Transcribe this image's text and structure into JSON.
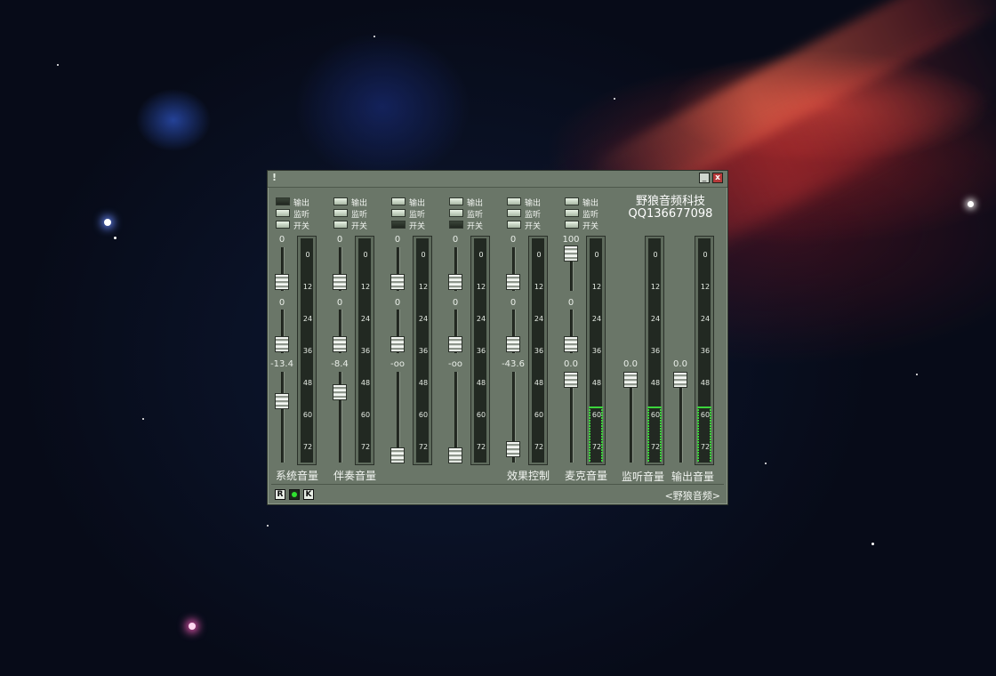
{
  "window": {
    "title_glyph": "!",
    "minimize_label": "_",
    "close_label": "x",
    "brand_line1": "野狼音频科技",
    "brand_line2": "QQ136677098",
    "footer_text": "<野狼音频>",
    "status_buttons": [
      "R",
      "",
      "K"
    ]
  },
  "toggle_labels": [
    "输出",
    "监听",
    "开关"
  ],
  "meter_ticks": [
    "0",
    "12",
    "24",
    "36",
    "48",
    "60",
    "72"
  ],
  "channels": [
    {
      "label": "系统音量",
      "values": [
        "0",
        "0",
        "-13.4"
      ],
      "toggles": [
        false,
        true,
        true
      ]
    },
    {
      "label": "伴奏音量",
      "values": [
        "0",
        "0",
        "-8.4"
      ],
      "toggles": [
        true,
        true,
        true
      ]
    },
    {
      "label": "",
      "values": [
        "0",
        "0",
        "-oo"
      ],
      "toggles": [
        true,
        true,
        false
      ]
    },
    {
      "label": "",
      "values": [
        "0",
        "0",
        "-oo"
      ],
      "toggles": [
        true,
        true,
        false
      ]
    },
    {
      "label": "效果控制",
      "values": [
        "0",
        "0",
        "-43.6"
      ],
      "toggles": [
        true,
        true,
        true
      ]
    },
    {
      "label": "麦克音量",
      "values": [
        "100",
        "0",
        "0.0"
      ],
      "toggles": [
        true,
        true,
        true
      ],
      "meter_level": 0.25
    }
  ],
  "outputs": [
    {
      "label": "监听音量",
      "value": "0.0",
      "meter_level": 0.25
    },
    {
      "label": "输出音量",
      "value": "0.0",
      "meter_level": 0.25
    }
  ]
}
